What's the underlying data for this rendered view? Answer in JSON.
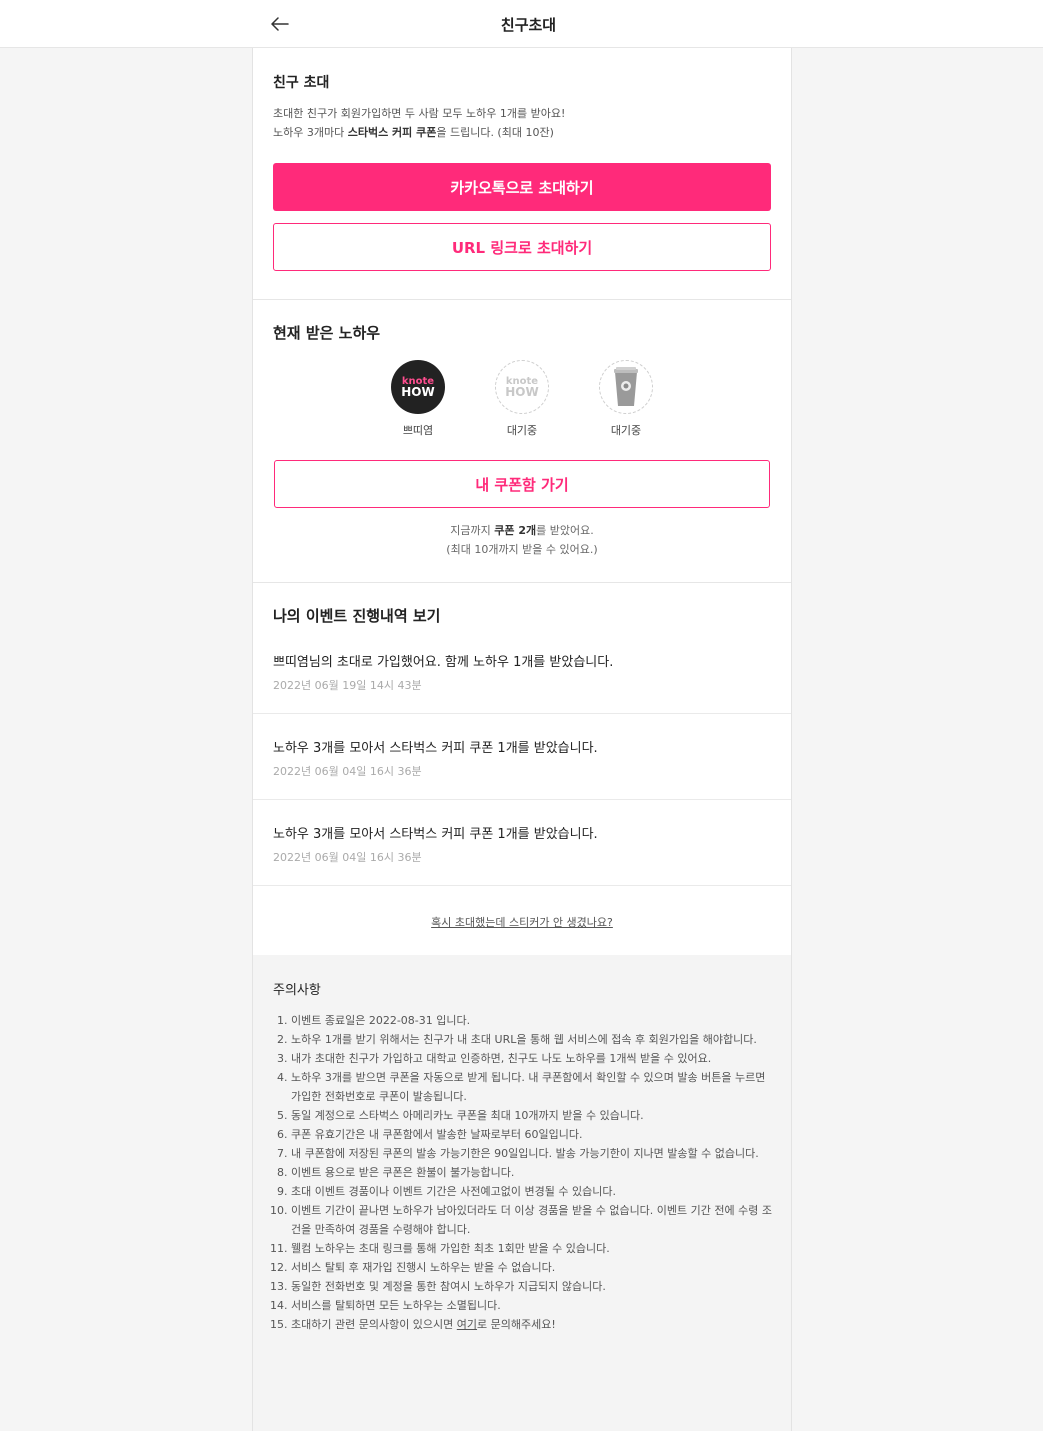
{
  "header": {
    "title": "친구초대"
  },
  "invite": {
    "heading": "친구 초대",
    "desc_line1": "초대한 친구가 회원가입하면 두 사람 모두 노하우 1개를 받아요!",
    "desc_line2_pre": "노하우 3개마다 ",
    "desc_line2_bold": "스타벅스 커피 쿠폰",
    "desc_line2_post": "을 드립니다. (최대 10잔)",
    "kakao_button": "카카오톡으로 초대하기",
    "url_button": "URL 링크로 초대하기"
  },
  "current": {
    "heading": "현재 받은 노하우",
    "logo_line1": "knote",
    "logo_line2": "HOW",
    "stickers": [
      {
        "caption": "쁘띠염",
        "state": "filled"
      },
      {
        "caption": "대기중",
        "state": "empty"
      },
      {
        "caption": "대기중",
        "state": "empty-coffee"
      }
    ],
    "coupon_button": "내 쿠폰함 가기",
    "note_line1_pre": "지금까지 ",
    "note_line1_bold": "쿠폰 2개",
    "note_line1_post": "를 받았어요.",
    "note_line2": "(최대 10개까지 받을 수 있어요.)"
  },
  "history": {
    "heading": "나의 이벤트 진행내역 보기",
    "items": [
      {
        "message": "쁘띠염님의 초대로 가입했어요. 함께 노하우 1개를 받았습니다.",
        "timestamp": "2022년 06월 19일 14시 43분"
      },
      {
        "message": "노하우 3개를 모아서 스타벅스 커피 쿠폰 1개를 받았습니다.",
        "timestamp": "2022년 06월 04일 16시 36분"
      },
      {
        "message": "노하우 3개를 모아서 스타벅스 커피 쿠폰 1개를 받았습니다.",
        "timestamp": "2022년 06월 04일 16시 36분"
      }
    ],
    "help_link": "혹시 초대했는데 스티커가 안 생겼나요?"
  },
  "notice": {
    "title": "주의사항",
    "items": [
      "이벤트 종료일은 2022-08-31 입니다.",
      "노하우 1개를 받기 위해서는 친구가 내 초대 URL을 통해 웹 서비스에 접속 후 회원가입을 해야합니다.",
      "내가 초대한 친구가 가입하고 대학교 인증하면, 친구도 나도 노하우를 1개씩 받을 수 있어요.",
      "노하우 3개를 받으면 쿠폰을 자동으로 받게 됩니다. 내 쿠폰함에서 확인할 수 있으며 발송 버튼을 누르면 가입한 전화번호로 쿠폰이 발송됩니다.",
      "동일 계정으로 스타벅스 아메리카노 쿠폰을 최대 10개까지 받을 수 있습니다.",
      "쿠폰 유효기간은 내 쿠폰함에서 발송한 날짜로부터 60일입니다.",
      "내 쿠폰함에 저장된 쿠폰의 발송 가능기한은 90일입니다. 발송 가능기한이 지나면 발송할 수 없습니다.",
      "이벤트 용으로 받은 쿠폰은 환불이 불가능합니다.",
      "초대 이벤트 경품이나 이벤트 기간은 사전예고없이 변경될 수 있습니다.",
      "이벤트 기간이 끝나면 노하우가 남아있더라도 더 이상 경품을 받을 수 없습니다. 이벤트 기간 전에 수령 조건을 만족하여 경품을 수령해야 합니다.",
      "웰컴 노하우는 초대 링크를 통해 가입한 최초 1회만 받을 수 있습니다.",
      "서비스 탈퇴 후 재가입 진행시 노하우는 받을 수 없습니다.",
      "동일한 전화번호 및 계정을 통한 참여시 노하우가 지급되지 않습니다.",
      "서비스를 탈퇴하면 모든 노하우는 소멸됩니다."
    ],
    "last_pre": "초대하기 관련 문의사항이 있으시면 ",
    "last_link": "여기",
    "last_post": "로 문의해주세요!"
  },
  "colors": {
    "accent": "#ff2a7a",
    "background": "#f5f5f5"
  }
}
